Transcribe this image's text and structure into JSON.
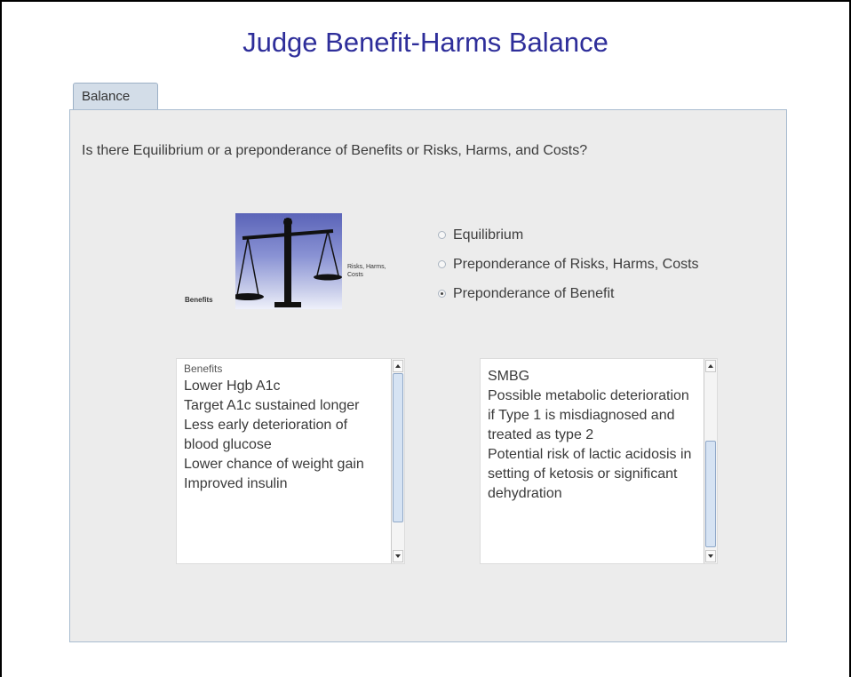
{
  "slide": {
    "title": "Judge Benefit-Harms Balance"
  },
  "tab": {
    "label": "Balance"
  },
  "question": "Is there Equilibrium or a preponderance of Benefits or Risks, Harms, and Costs?",
  "scale_image": {
    "benefits_label": "Benefits",
    "risks_label": "Risks, Harms, Costs"
  },
  "options": [
    {
      "label": "Equilibrium",
      "selected": false
    },
    {
      "label": "Preponderance of Risks, Harms, Costs",
      "selected": false
    },
    {
      "label": "Preponderance of Benefit",
      "selected": true
    }
  ],
  "benefits_list": {
    "legend": "Benefits",
    "items": [
      "Lower Hgb A1c",
      "Target A1c sustained longer",
      "Less early deterioration of blood glucose",
      "Lower chance of weight gain",
      "Improved insulin"
    ]
  },
  "harms_list": {
    "items": [
      "SMBG",
      "Possible metabolic deterioration if Type 1 is misdiagnosed and treated as type 2",
      "Potential risk of lactic acidosis in setting of ketosis or significant dehydration"
    ]
  },
  "colors": {
    "title": "#2e2e9a",
    "tab_bg": "#d3dde8",
    "panel_bg": "#ececec",
    "scroll_thumb": "#d6e3f3"
  }
}
